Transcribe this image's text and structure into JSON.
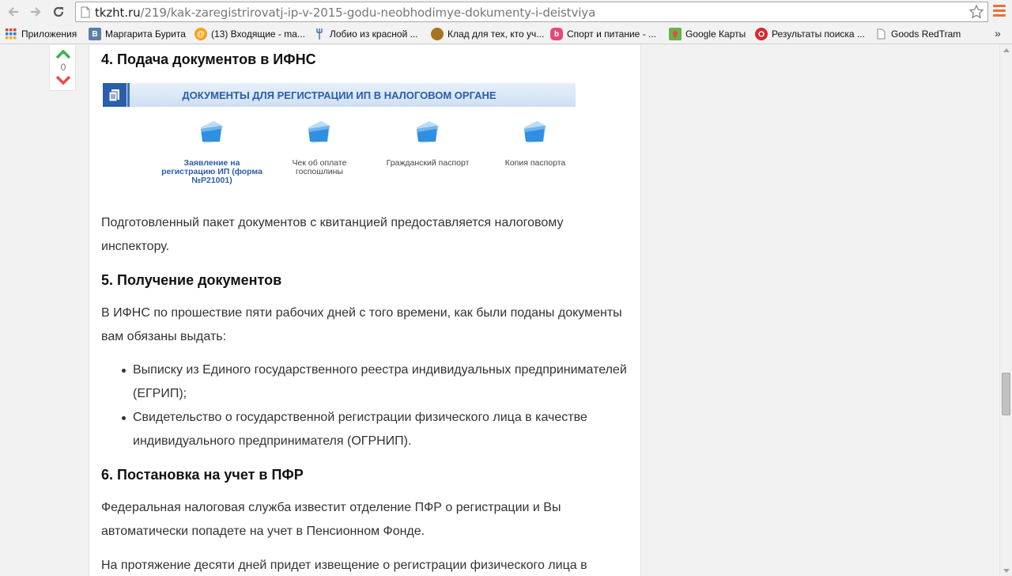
{
  "browser": {
    "url_host": "tkzht.ru",
    "url_path": "/219/kak-zaregistrirovatj-ip-v-2015-godu-neobhodimye-dokumenty-i-deistviya",
    "menu_color": "#e8703a"
  },
  "bookmarks": {
    "items": [
      {
        "label": "Приложения",
        "icon": "apps-grid-icon"
      },
      {
        "label": "Маргарита Бурита",
        "icon": "vk-icon"
      },
      {
        "label": "(13) Входящие - ma...",
        "icon": "mail-at-icon"
      },
      {
        "label": "Лобио из красной ...",
        "icon": "fork-icon"
      },
      {
        "label": "Клад для тех, кто уч...",
        "icon": "acorn-icon"
      },
      {
        "label": "Спорт и питание - ...",
        "icon": "b-icon"
      },
      {
        "label": "Google Карты",
        "icon": "google-maps-icon"
      },
      {
        "label": "Результаты поиска ...",
        "icon": "search-result-icon"
      },
      {
        "label": "Goods RedTram",
        "icon": "page-icon"
      }
    ],
    "more": "»"
  },
  "vote": {
    "count": "0",
    "up_color": "#3cb34a",
    "down_color": "#e84c4c"
  },
  "article": {
    "h4": "4. Подача документов в ИФНС",
    "infographic": {
      "title": "ДОКУМЕНТЫ ДЛЯ РЕГИСТРАЦИИ ИП В НАЛОГОВОМ ОРГАНЕ",
      "items": [
        "Заявление на регистрацию ИП (форма №Р21001)",
        "Чек об оплате госпошлины",
        "Гражданский паспорт",
        "Копия паспорта"
      ]
    },
    "p4_line1": "Подготовленный пакет документов  с квитанцией предоставляется налоговому",
    "p4_line2": "инспектору.",
    "h5": "5. Получение документов",
    "p5_line1": "В ИФНС по прошествие пяти рабочих дней с того времени, как были поданы документы",
    "p5_line2": " вам обязаны выдать:",
    "bullets": [
      {
        "line1": "Выписку из Единого государственного реестра индивидуальных предпринимателей",
        "line2": "(ЕГРИП);"
      },
      {
        "line1": "Свидетельство о государственной регистрации физического лица в качестве",
        "line2": "индивидуального предпринимателя (ОГРНИП)."
      }
    ],
    "h6": "6. Постановка на учет в ПФР",
    "p6_line1": "Федеральная налоговая служба известит отделение ПФР о регистрации и Вы",
    "p6_line2": "автоматически попадете  на учет в Пенсионном Фонде.",
    "p7_line1": "На протяжение десяти дней придет извещение о регистрации физического лица в"
  }
}
